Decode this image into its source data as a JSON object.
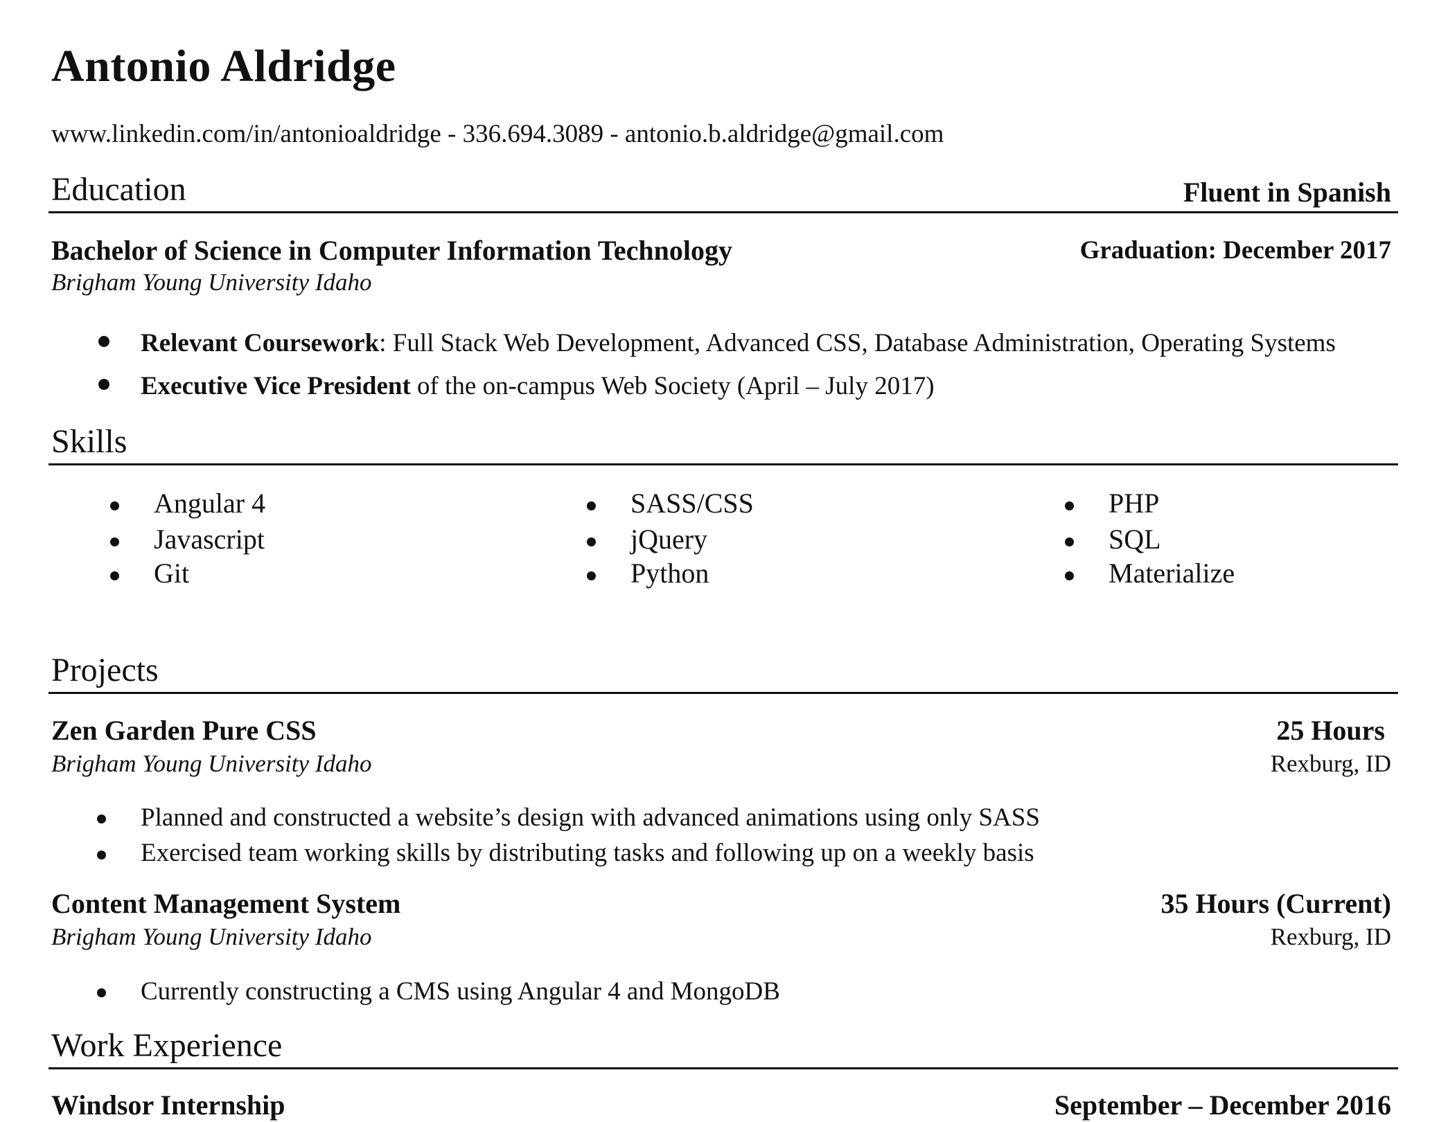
{
  "header": {
    "name": "Antonio Aldridge",
    "contact": "www.linkedin.com/in/antonioaldridge - 336.694.3089 - antonio.b.aldridge@gmail.com"
  },
  "education": {
    "title": "Education",
    "language": "Fluent in Spanish",
    "degree": "Bachelor of Science in Computer Information Technology",
    "graduation": "Graduation: December 2017",
    "school": "Brigham Young University Idaho",
    "bullets": [
      {
        "bold": "Relevant Coursework",
        "text": ": Full Stack Web Development, Advanced CSS, Database Administration, Operating Systems"
      },
      {
        "bold": "Executive Vice President",
        "text": " of the on-campus Web Society (April – July 2017)"
      }
    ]
  },
  "skills": {
    "title": "Skills",
    "columns": [
      [
        "Angular 4",
        "Javascript",
        "Git"
      ],
      [
        "SASS/CSS",
        "jQuery",
        "Python"
      ],
      [
        "PHP",
        "SQL",
        "Materialize"
      ]
    ]
  },
  "projects": {
    "title": "Projects",
    "items": [
      {
        "name": "Zen Garden Pure CSS",
        "hours": "25 Hours",
        "school": "Brigham Young University Idaho",
        "location": "Rexburg, ID",
        "bullets": [
          "Planned and constructed a website’s design with advanced animations using only SASS",
          "Exercised team working skills by distributing tasks and following up on a weekly basis"
        ]
      },
      {
        "name": "Content Management System",
        "hours": "35 Hours (Current)",
        "school": "Brigham Young University Idaho",
        "location": "Rexburg, ID",
        "bullets": [
          "Currently constructing a CMS using Angular 4 and MongoDB"
        ]
      }
    ]
  },
  "work": {
    "title": "Work Experience",
    "items": [
      {
        "name": "Windsor Internship",
        "dates": "September – December 2016"
      }
    ]
  }
}
